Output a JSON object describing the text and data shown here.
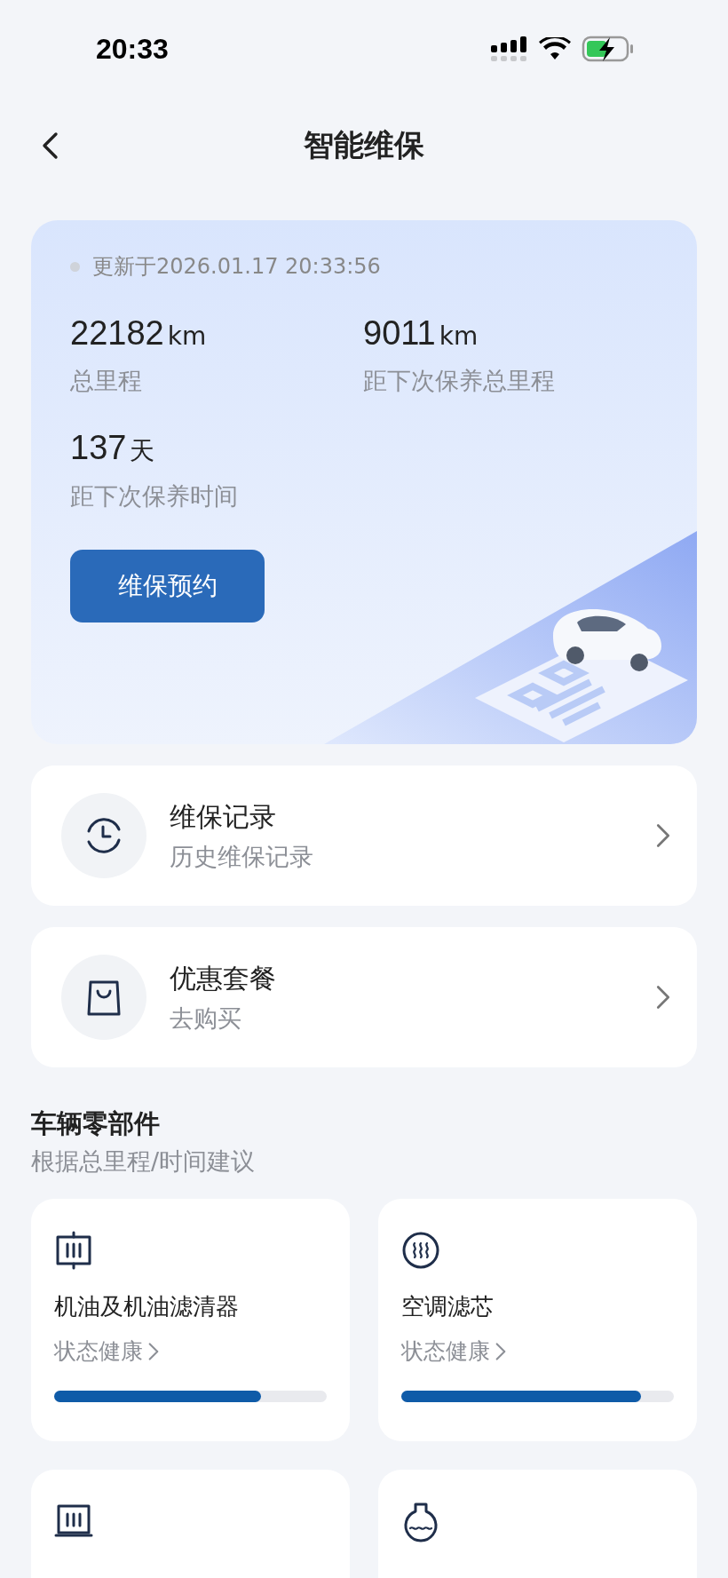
{
  "status_bar": {
    "time": "20:33"
  },
  "header": {
    "title": "智能维保"
  },
  "summary": {
    "updated": "更新于2026.01.17 20:33:56",
    "stats": [
      {
        "value": "22182",
        "unit": "km",
        "label": "总里程"
      },
      {
        "value": "9011",
        "unit": "km",
        "label": "距下次保养总里程"
      },
      {
        "value": "137",
        "unit": "天",
        "label": "距下次保养时间"
      }
    ],
    "button": "维保预约"
  },
  "entries": [
    {
      "kind": "clock",
      "title": "维保记录",
      "subtitle": "历史维保记录"
    },
    {
      "kind": "bag",
      "title": "优惠套餐",
      "subtitle": "去购买"
    }
  ],
  "parts_section": {
    "title": "车辆零部件",
    "subtitle": "根据总里程/时间建议",
    "parts": [
      {
        "kind": "oil",
        "name": "机油及机油滤清器",
        "status": "状态健康",
        "level": 0.76
      },
      {
        "kind": "ac",
        "name": "空调滤芯",
        "status": "状态健康",
        "level": 0.88
      },
      {
        "kind": "air"
      },
      {
        "kind": "coolant"
      }
    ]
  }
}
